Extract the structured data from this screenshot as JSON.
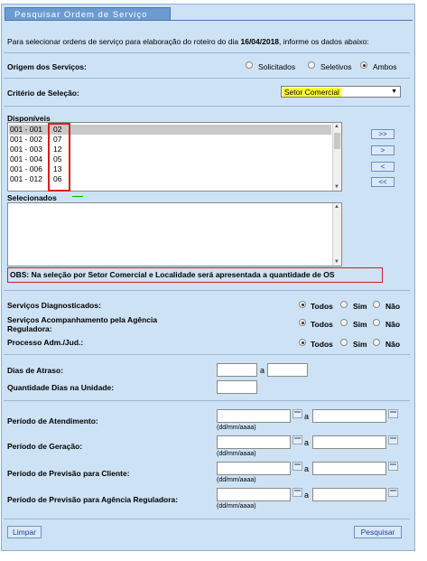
{
  "title": "Pesquisar Ordem de Serviço",
  "intro": {
    "prefix": "Para selecionar ordens de serviço para elaboração do roteiro do dia",
    "date": "16/04/2018",
    "suffix": ", informe os dados abaixo:"
  },
  "origem": {
    "label": "Origem dos Serviços:",
    "options": [
      "Solicitados",
      "Seletivos",
      "Ambos"
    ],
    "selected": "Ambos"
  },
  "criterio": {
    "label": "Critério de Seleção:",
    "value": "Setor Comercial"
  },
  "disponiveis": {
    "label": "Disponíveis",
    "items": [
      {
        "code": "001 - 001",
        "num": "02"
      },
      {
        "code": "001 - 002",
        "num": "07"
      },
      {
        "code": "001 - 003",
        "num": "12"
      },
      {
        "code": "001 - 004",
        "num": "05"
      },
      {
        "code": "001 - 006",
        "num": "13"
      },
      {
        "code": "001 - 012",
        "num": "06"
      }
    ]
  },
  "transfer_buttons": [
    ">>",
    ">",
    "<",
    "<<"
  ],
  "selecionados": {
    "label": "Selecionados"
  },
  "obs": "OBS: Na seleção por Setor Comercial e Localidade será apresentada a quantidade de OS",
  "triple_options": [
    "Todos",
    "Sim",
    "Não"
  ],
  "servicos_diag": {
    "label": "Serviços Diagnosticados:",
    "selected": "Todos"
  },
  "servicos_acomp": {
    "label_line1": "Serviços Acompanhamento pela Agência",
    "label_line2": "Reguladora:",
    "selected": "Todos"
  },
  "processo": {
    "label": "Processo Adm./Jud.:",
    "selected": "Todos"
  },
  "dias_atraso": {
    "label": "Dias de Atraso:",
    "sep": "a"
  },
  "qtd_dias": {
    "label": "Quantidade Dias na Unidade:"
  },
  "periodos": [
    {
      "label": "Período de Atendimento:"
    },
    {
      "label": "Período de Geração:"
    },
    {
      "label": "Período de Previsão para Cliente:"
    },
    {
      "label": "Período de Previsão para Agência Reguladora:"
    }
  ],
  "date_hint": "(dd/mm/aaaa)",
  "sep": "a",
  "buttons": {
    "limpar": "Limpar",
    "pesquisar": "Pesquisar"
  }
}
